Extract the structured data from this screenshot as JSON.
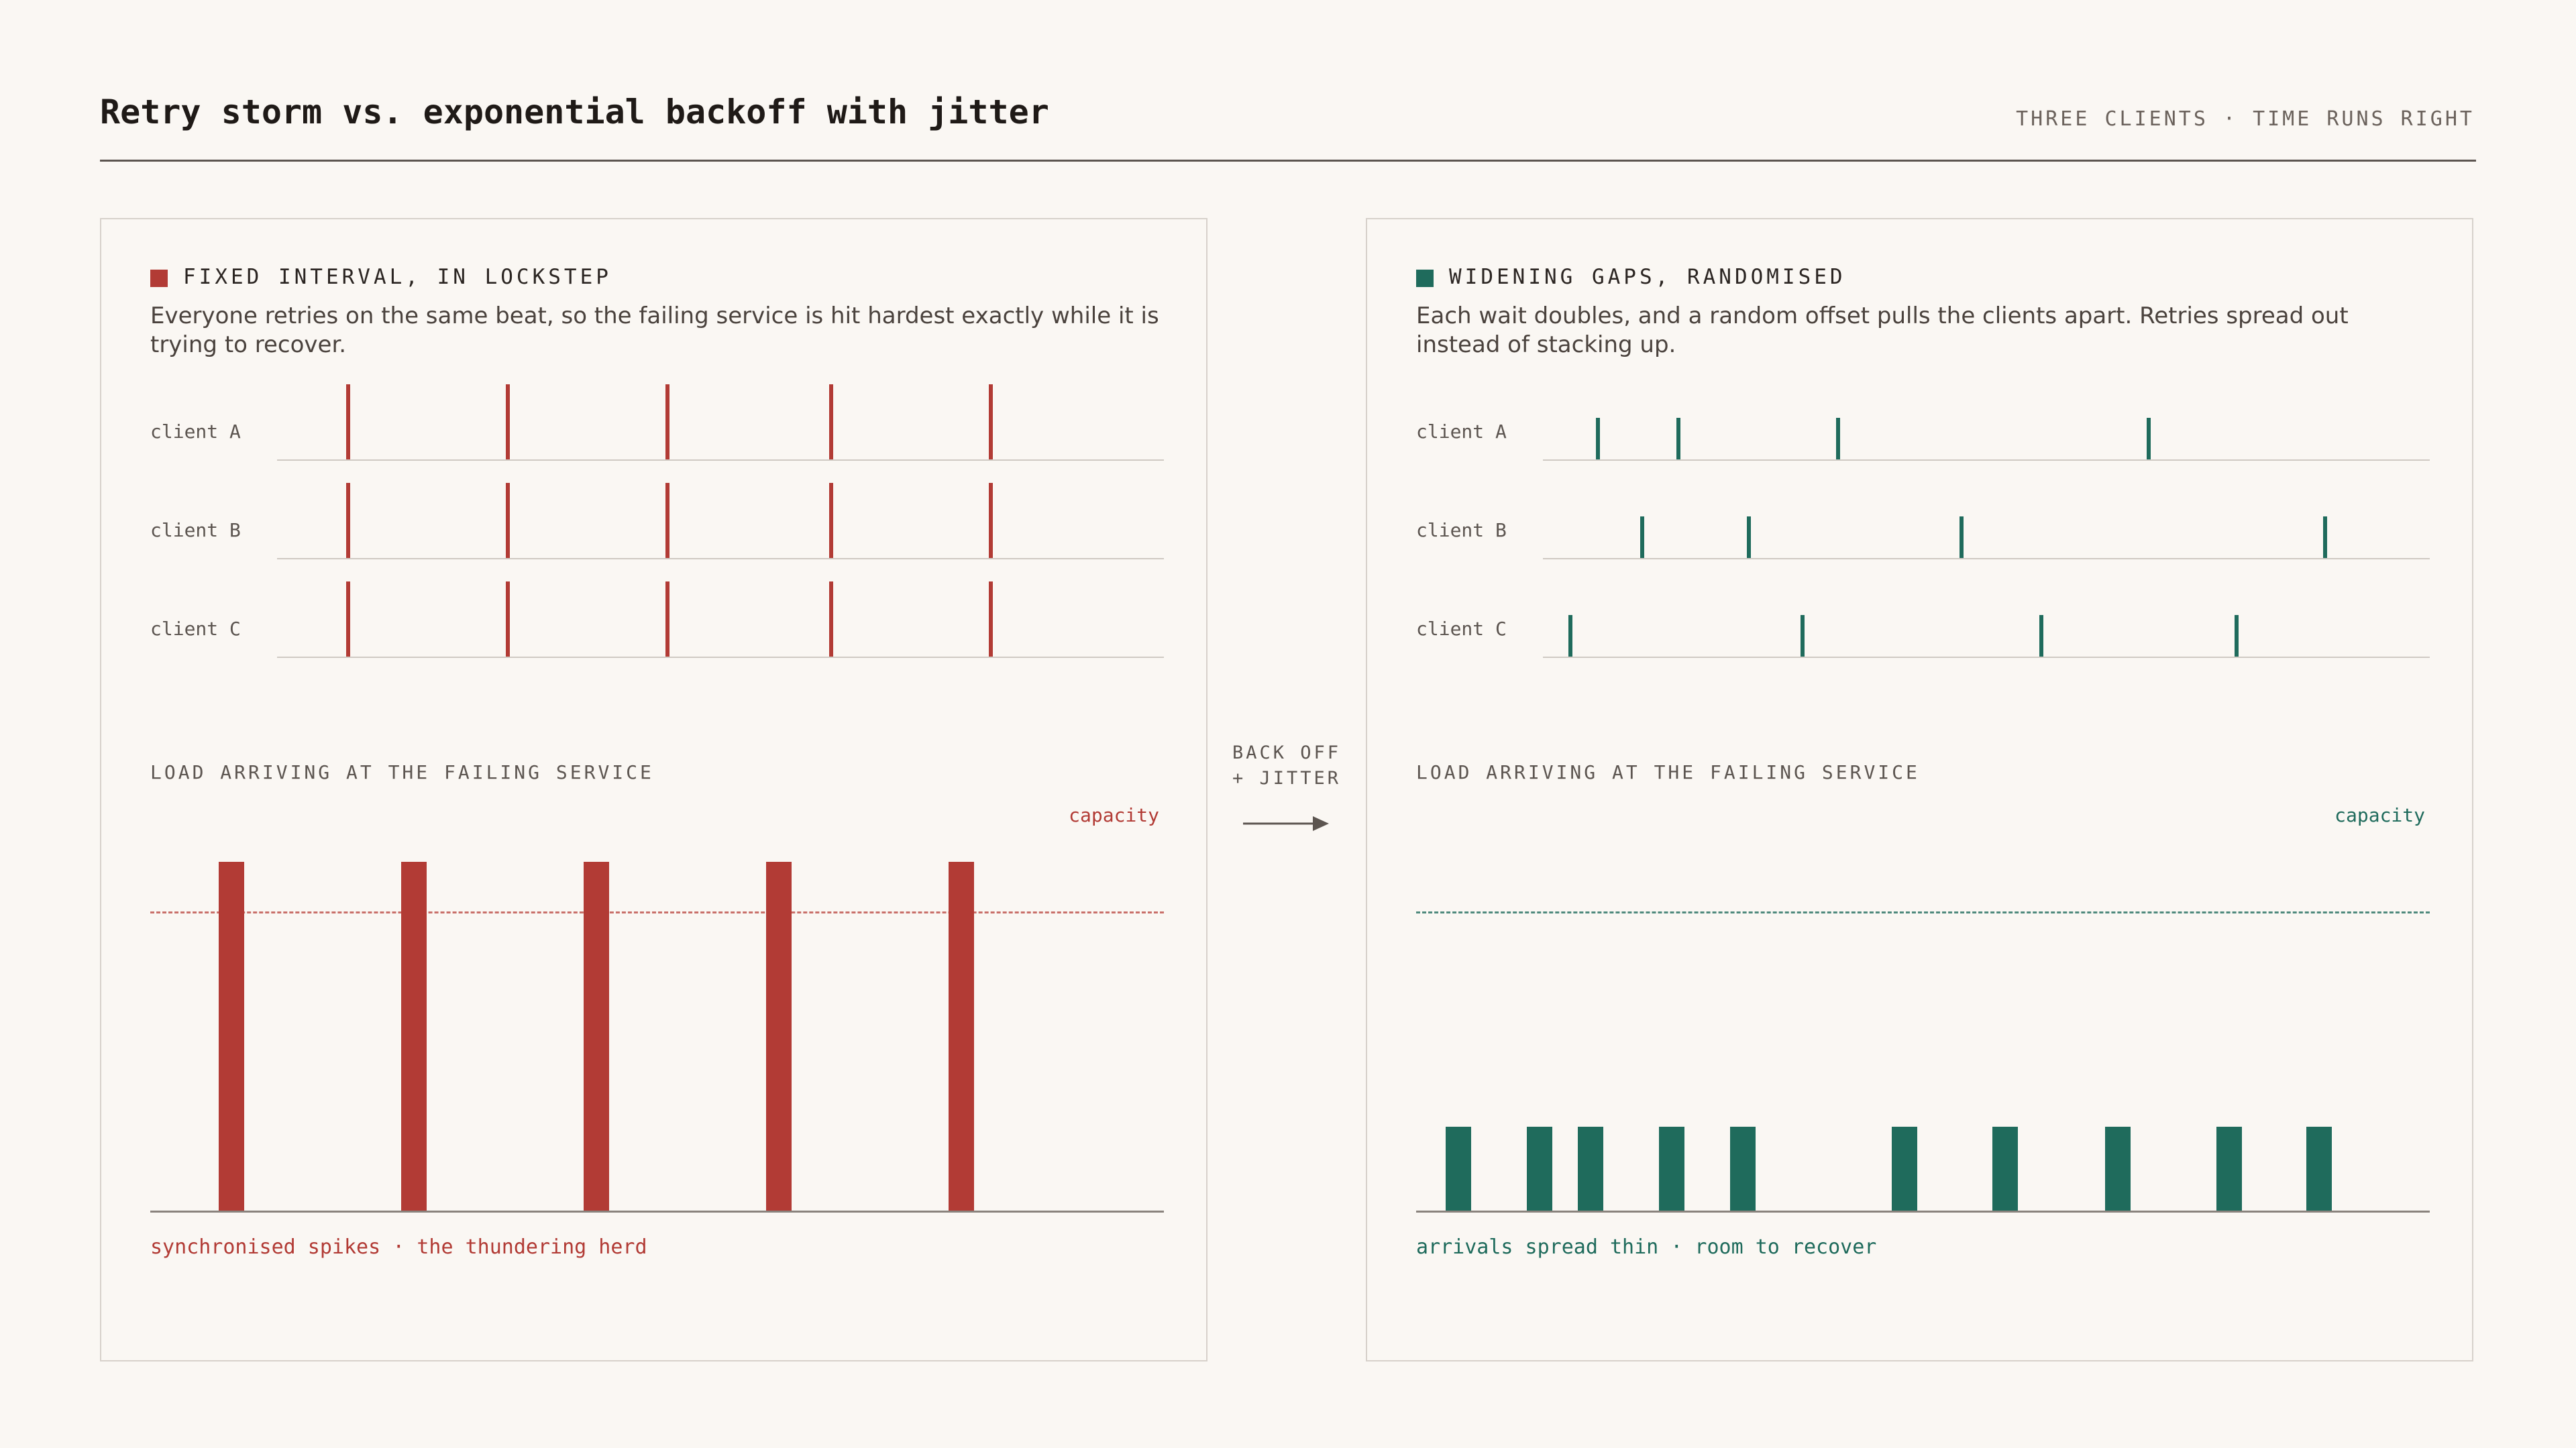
{
  "header": {
    "title": "Retry storm vs. exponential backoff with jitter",
    "subtitle": "THREE CLIENTS · TIME RUNS RIGHT"
  },
  "colors": {
    "fixed": "#b23b35",
    "jitter": "#1f6b5c"
  },
  "left": {
    "title": "FIXED INTERVAL, IN LOCKSTEP",
    "description": "Everyone retries on the same beat, so the failing service is hit hardest exactly while it is trying to recover.",
    "clients": [
      {
        "label": "client A",
        "retries": [
          0.08,
          0.26,
          0.44,
          0.625,
          0.805
        ]
      },
      {
        "label": "client B",
        "retries": [
          0.08,
          0.26,
          0.44,
          0.625,
          0.805
        ]
      },
      {
        "label": "client C",
        "retries": [
          0.08,
          0.26,
          0.44,
          0.625,
          0.805
        ]
      }
    ],
    "load_label": "LOAD ARRIVING AT THE FAILING SERVICE",
    "capacity_label": "capacity",
    "capacity_level": 0.86,
    "load": [
      {
        "t": 0.08,
        "level": 1.0
      },
      {
        "t": 0.26,
        "level": 1.0
      },
      {
        "t": 0.44,
        "level": 1.0
      },
      {
        "t": 0.62,
        "level": 1.0
      },
      {
        "t": 0.8,
        "level": 1.0
      }
    ],
    "caption": "synchronised spikes · the thundering herd"
  },
  "right": {
    "title": "WIDENING GAPS, RANDOMISED",
    "description": "Each wait doubles, and a random offset pulls the clients apart. Retries spread out instead of stacking up.",
    "clients": [
      {
        "label": "client A",
        "retries": [
          0.062,
          0.153,
          0.333,
          0.683
        ]
      },
      {
        "label": "client B",
        "retries": [
          0.112,
          0.232,
          0.472,
          0.882
        ]
      },
      {
        "label": "client C",
        "retries": [
          0.031,
          0.293,
          0.562,
          0.782
        ]
      }
    ],
    "load_label": "LOAD ARRIVING AT THE FAILING SERVICE",
    "capacity_label": "capacity",
    "capacity_level": 0.86,
    "load": [
      {
        "t": 0.042,
        "level": 0.24
      },
      {
        "t": 0.122,
        "level": 0.24
      },
      {
        "t": 0.172,
        "level": 0.24
      },
      {
        "t": 0.252,
        "level": 0.24
      },
      {
        "t": 0.322,
        "level": 0.24
      },
      {
        "t": 0.482,
        "level": 0.24
      },
      {
        "t": 0.581,
        "level": 0.24
      },
      {
        "t": 0.692,
        "level": 0.24
      },
      {
        "t": 0.802,
        "level": 0.24
      },
      {
        "t": 0.891,
        "level": 0.24
      }
    ],
    "caption": "arrivals spread thin · room to recover"
  },
  "transition": {
    "line1": "BACK OFF",
    "line2": "+ JITTER"
  }
}
